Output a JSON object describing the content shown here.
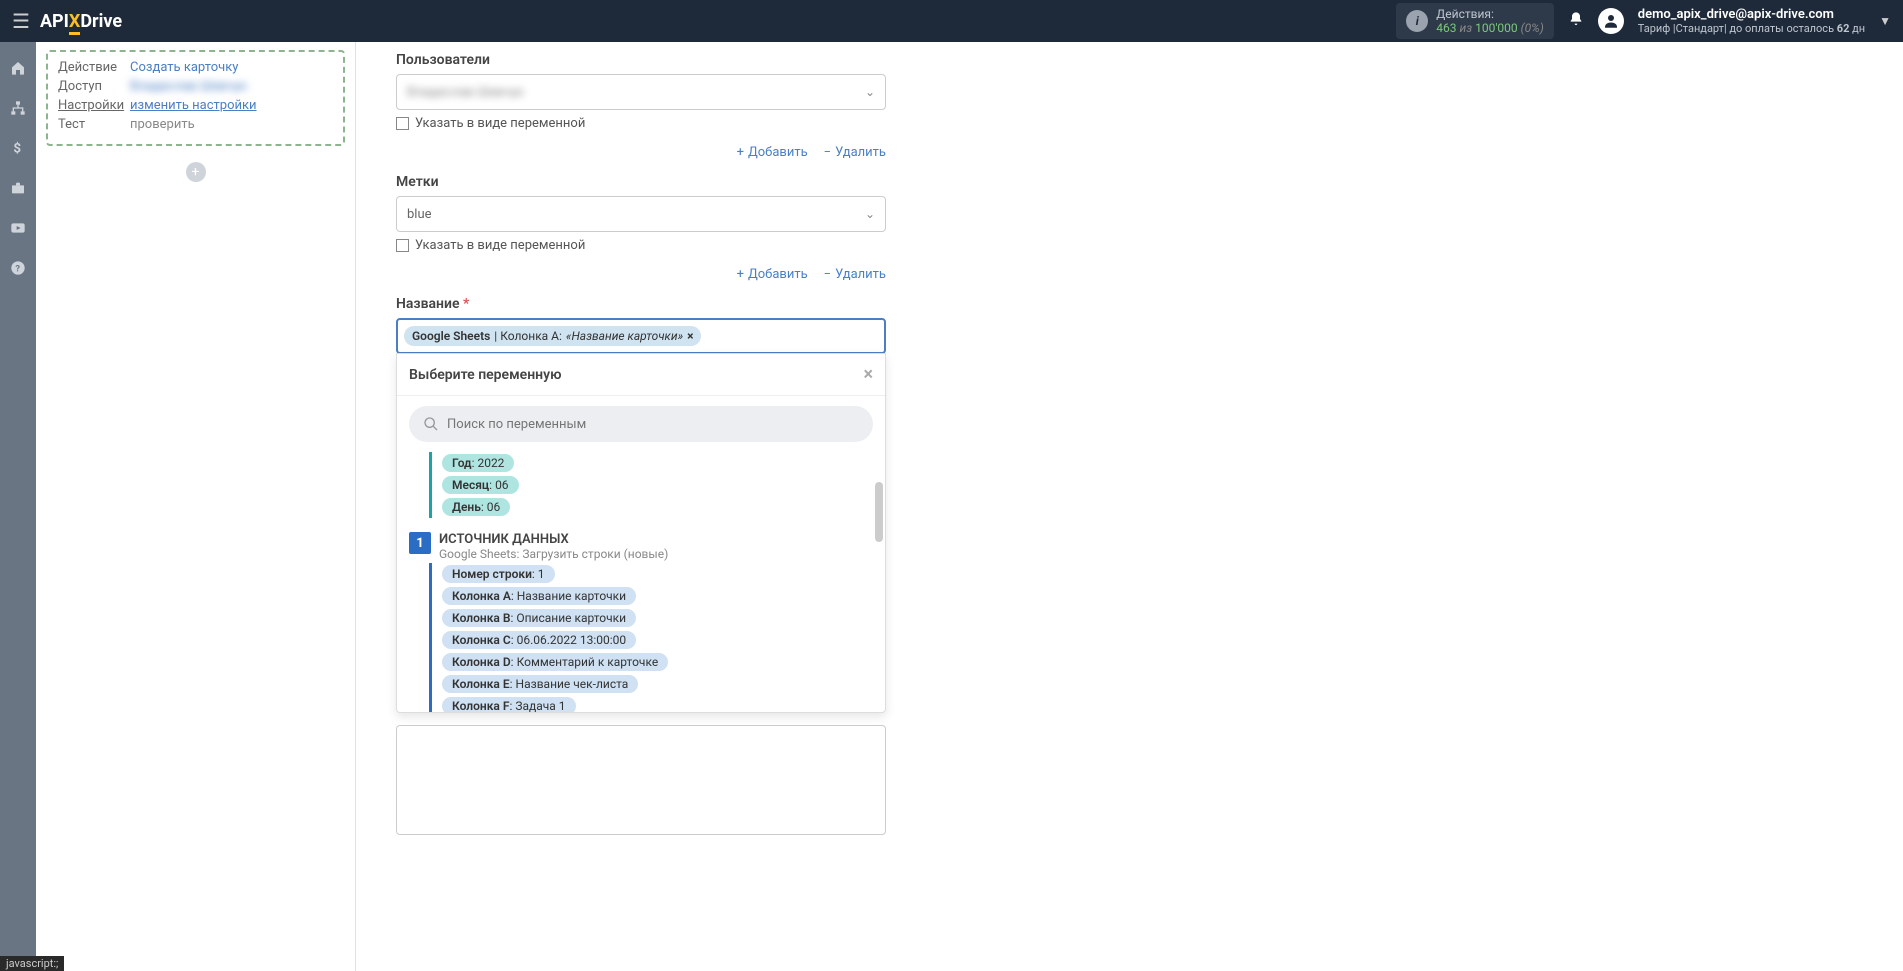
{
  "header": {
    "logo": {
      "api": "API",
      "x": "X",
      "drive": "Drive"
    },
    "actions": {
      "title": "Действия:",
      "count": "463",
      "of": "из",
      "total": "100'000",
      "pct": "(0%)"
    },
    "user": {
      "email": "demo_apix_drive@apix-drive.com",
      "tariff_prefix": "Тариф |Стандарт| до оплаты осталось ",
      "days": "62",
      "days_suffix": " дн"
    }
  },
  "sidebar_tips": [
    "home",
    "sitemap",
    "dollar",
    "briefcase",
    "youtube",
    "help"
  ],
  "step_card": {
    "action_label": "Действие",
    "action_value": "Создать карточку",
    "access_label": "Доступ",
    "access_value": "Владислав Шевчук",
    "settings_label": "Настройки",
    "settings_value": "изменить настройки",
    "test_label": "Тест",
    "test_value": "проверить"
  },
  "fields": {
    "users": {
      "label": "Пользователи",
      "value": "Владислав Шевчук",
      "variable_checkbox": "Указать в виде переменной"
    },
    "labels": {
      "label": "Метки",
      "value": "blue",
      "variable_checkbox": "Указать в виде переменной"
    },
    "name": {
      "label": "Название",
      "tag_source": "Google Sheets",
      "tag_sep": " | Колонка A: ",
      "tag_value": "«Название карточки»"
    },
    "add": "Добавить",
    "delete": "Удалить"
  },
  "dropdown": {
    "title": "Выберите переменную",
    "search_placeholder": "Поиск по переменным",
    "date_vars": [
      {
        "key": "Год",
        "val": "2022"
      },
      {
        "key": "Месяц",
        "val": "06"
      },
      {
        "key": "День",
        "val": "06"
      }
    ],
    "source": {
      "num": "1",
      "title": "ИСТОЧНИК ДАННЫХ",
      "subtitle": "Google Sheets: Загрузить строки (новые)"
    },
    "source_vars": [
      {
        "key": "Номер строки",
        "val": "1"
      },
      {
        "key": "Колонка A",
        "val": "Название карточки"
      },
      {
        "key": "Колонка B",
        "val": "Описание карточки"
      },
      {
        "key": "Колонка C",
        "val": "06.06.2022 13:00:00"
      },
      {
        "key": "Колонка D",
        "val": "Комментарий к карточке"
      },
      {
        "key": "Колонка E",
        "val": "Название чек-листа"
      },
      {
        "key": "Колонка F",
        "val": "Задача 1"
      }
    ]
  },
  "status_bar": "javascript:;"
}
